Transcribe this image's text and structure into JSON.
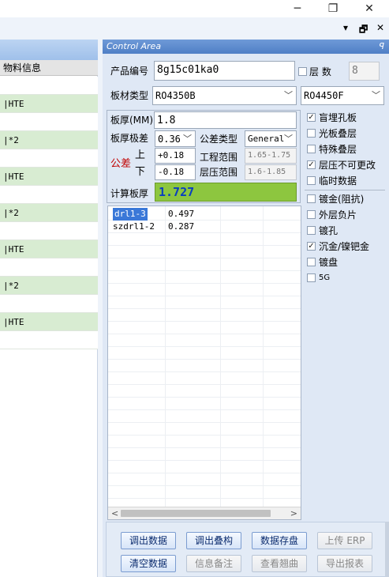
{
  "window": {
    "minimize": "─",
    "restore": "❐",
    "close": "✕"
  },
  "panelctl": {
    "pin": "▾",
    "float": "🗗",
    "close": "✕"
  },
  "left": {
    "header": "物料信息",
    "rows": [
      "",
      "|HTE",
      "",
      "|*2",
      "",
      "|HTE",
      "",
      "|*2",
      "",
      "|HTE",
      "",
      "|*2",
      "",
      "|HTE",
      ""
    ]
  },
  "control": {
    "title": "Control Area",
    "pin": "ꟼ",
    "product_label": "产品编号",
    "product_value": "8g15c01ka0",
    "layers_label": "层  数",
    "layers_value": "8",
    "board_label": "板材类型",
    "board_value": "RO4350B",
    "board_value2": "RO4450F",
    "thick_label": "板厚(MM)",
    "thick_value": "1.8",
    "tol_label": "板厚极差",
    "tol_value": "0.36",
    "toltype_label": "公差类型",
    "toltype_value": "General",
    "gongcha": "公差",
    "up": "上",
    "down": "下",
    "up_value": "+0.18",
    "down_value": "-0.18",
    "eng_label": "工程范围",
    "eng_value": "1.65-1.75",
    "press_label": "层压范围",
    "press_value": "1.6-1.85",
    "calc_label": "计算板厚",
    "calc_value": "1.727"
  },
  "checks": [
    {
      "label": "盲埋孔板",
      "checked": true
    },
    {
      "label": "光板叠层",
      "checked": false
    },
    {
      "label": "特殊叠层",
      "checked": false
    },
    {
      "label": "层压不可更改",
      "checked": true
    },
    {
      "label": "临时数据",
      "checked": false
    },
    {
      "label": "镀金(阻抗)",
      "checked": false
    },
    {
      "label": "外层负片",
      "checked": false
    },
    {
      "label": "镀孔",
      "checked": false
    },
    {
      "label": "沉金/镍钯金",
      "checked": true
    },
    {
      "label": "镀盘",
      "checked": false
    },
    {
      "label": "5G",
      "checked": false
    }
  ],
  "grid": {
    "rows": [
      {
        "name": "drl1-3",
        "value": "0.497"
      },
      {
        "name": "szdrl1-2",
        "value": "0.287"
      }
    ],
    "left_arrow": "<",
    "right_arrow": ">"
  },
  "buttons": {
    "row1": [
      {
        "label": "调出数据",
        "enabled": true
      },
      {
        "label": "调出叠构",
        "enabled": true
      },
      {
        "label": "数据存盘",
        "enabled": true
      },
      {
        "label": "上传 ERP",
        "enabled": false
      }
    ],
    "row2": [
      {
        "label": "清空数据",
        "enabled": true
      },
      {
        "label": "信息备注",
        "enabled": false
      },
      {
        "label": "查看翘曲",
        "enabled": false
      },
      {
        "label": "导出报表",
        "enabled": false
      }
    ]
  },
  "colors": {
    "calc_bg": "#8dc63f",
    "calc_text": "#0a3fbf",
    "gongcha": "#c00000",
    "header_blue": "#5a88cc"
  }
}
